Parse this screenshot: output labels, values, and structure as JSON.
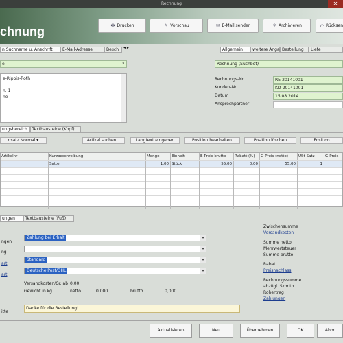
{
  "window": {
    "title": "Rechnung",
    "close_glyph": "✕"
  },
  "header": {
    "title": "chnung"
  },
  "toolbar": [
    {
      "label": "Drucken",
      "icon": "printer-icon",
      "glyph": "🖶"
    },
    {
      "label": "Vorschau",
      "icon": "preview-icon",
      "glyph": "✎"
    },
    {
      "label": "E-Mail senden",
      "icon": "mail-icon",
      "glyph": "✉"
    },
    {
      "label": "Archivieren",
      "icon": "archive-icon",
      "glyph": "⚲"
    },
    {
      "label": "Rücksen",
      "icon": "back-icon",
      "glyph": "⤺"
    }
  ],
  "left_tabs": [
    "n Suchname u. Anschrift",
    "E-Mail-Adresse",
    "Besch"
  ],
  "left_tab_arrows": "◂ ▸",
  "left_search_value": "e",
  "address_lines": [
    "e-Rippis-Roth",
    "",
    "n. 1",
    "ne"
  ],
  "right_tabs": [
    "Allgemein",
    "weitere Angaben",
    "Bestellung",
    "Liefe"
  ],
  "right_top_value": "Rechnung (Suchbet)",
  "right_fields": [
    {
      "label": "Rechnungs-Nr",
      "value": "RE-20141001"
    },
    {
      "label": "Kunden-Nr",
      "value": "KD-20141001"
    },
    {
      "label": "Datum",
      "value": "15.08.2014"
    },
    {
      "label": "Ansprechpartner",
      "value": ""
    }
  ],
  "pos_tabs": [
    "ungsbereich",
    "Textbausteine (Kopf)"
  ],
  "pos_buttons": [
    "nsatz Normal ▾",
    "Artikel suchen...",
    "Langtext eingeben",
    "Position bearbeiten",
    "Position löschen",
    "Position"
  ],
  "grid": {
    "columns": [
      "Artikelnr",
      "Kurzbeschreibung",
      "Menge",
      "Einheit",
      "E-Preis brutto",
      "Rabatt (%)",
      "G-Preis (netto)",
      "USt-Satz",
      "G-Preis"
    ],
    "rows": [
      [
        "",
        "Sattel",
        "1,00",
        "Stück",
        "55,00",
        "0,00",
        "55,00",
        "1",
        ""
      ]
    ],
    "empty_row_count": 6
  },
  "bottom_tabs": [
    "ungen",
    "Textbausteine (Fuß)"
  ],
  "form_labels": [
    "ngen",
    "ng",
    "art",
    "art",
    "itte"
  ],
  "dropdowns": [
    {
      "value": "Zahlung bei Erhalt",
      "highlight": true
    },
    {
      "value": "",
      "highlight": false
    },
    {
      "value": "Standard",
      "highlight": true
    },
    {
      "value": "Deutsche Post/DHL",
      "highlight": true
    }
  ],
  "shipping_lines": [
    {
      "label": "Versandkosten/Gr. ab",
      "v1": "0,00",
      "v2": "",
      "v3": "",
      "v4": ""
    },
    {
      "label": "Gewicht in kg",
      "v1": "netto",
      "v2": "0,000",
      "v3": "brutto",
      "v4": "0,000"
    }
  ],
  "remark_value": "Danke für die Bestellung!",
  "summary": [
    {
      "text": "Zwischensumme",
      "kind": "label"
    },
    {
      "text": "Versandkosten",
      "kind": "link"
    },
    {
      "text": "",
      "kind": "spacer"
    },
    {
      "text": "Summe netto",
      "kind": "label"
    },
    {
      "text": "Mehrwertsteuer",
      "kind": "label"
    },
    {
      "text": "Summe brutto",
      "kind": "label"
    },
    {
      "text": "",
      "kind": "spacer"
    },
    {
      "text": "Rabatt",
      "kind": "label"
    },
    {
      "text": "Preisnachlass",
      "kind": "link"
    },
    {
      "text": "",
      "kind": "spacer"
    },
    {
      "text": "Rechnungssumme",
      "kind": "label"
    },
    {
      "text": "abzügl. Skonto",
      "kind": "label"
    },
    {
      "text": "Rohertrag",
      "kind": "label"
    },
    {
      "text": "Zahlungen",
      "kind": "link"
    }
  ],
  "bottom_buttons": [
    "Aktualisieren",
    "Neu",
    "Übernehmen",
    "OK",
    "Abbr"
  ],
  "colors": {
    "accent_green": "#dff3cf",
    "header_dark": "#4a6a4f",
    "link": "#1d3d8f"
  }
}
